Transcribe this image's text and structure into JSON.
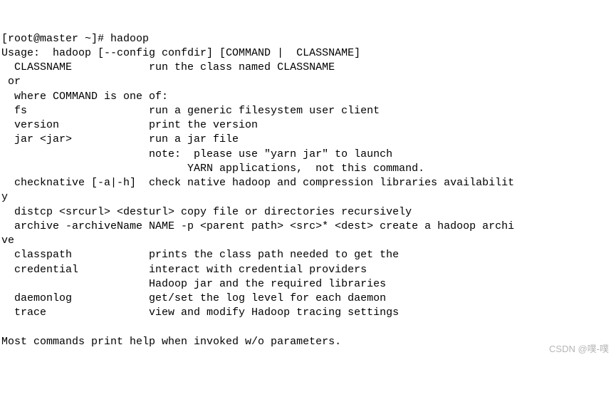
{
  "lines": {
    "l0": "[root@master ~]# hadoop",
    "l1": "Usage:  hadoop [--config confdir] [COMMAND |  CLASSNAME]",
    "l2": "  CLASSNAME            run the class named CLASSNAME",
    "l3": " or",
    "l4": "  where COMMAND is one of:",
    "l5": "  fs                   run a generic filesystem user client",
    "l6": "  version              print the version",
    "l7": "  jar <jar>            run a jar file",
    "l8": "                       note:  please use \"yarn jar\" to launch",
    "l9": "                             YARN applications,  not this command.",
    "l10": "  checknative [-a|-h]  check native hadoop and compression libraries availabilit",
    "l11": "y",
    "l12": "  distcp <srcurl> <desturl> copy file or directories recursively",
    "l13": "  archive -archiveName NAME -p <parent path> <src>* <dest> create a hadoop archi",
    "l14": "ve",
    "l15": "  classpath            prints the class path needed to get the",
    "l16": "  credential           interact with credential providers",
    "l17": "                       Hadoop jar and the required libraries",
    "l18": "  daemonlog            get/set the log level for each daemon",
    "l19": "  trace                view and modify Hadoop tracing settings",
    "l20": "",
    "l21": "Most commands print help when invoked w/o parameters."
  },
  "watermark": "CSDN @噗-噗"
}
